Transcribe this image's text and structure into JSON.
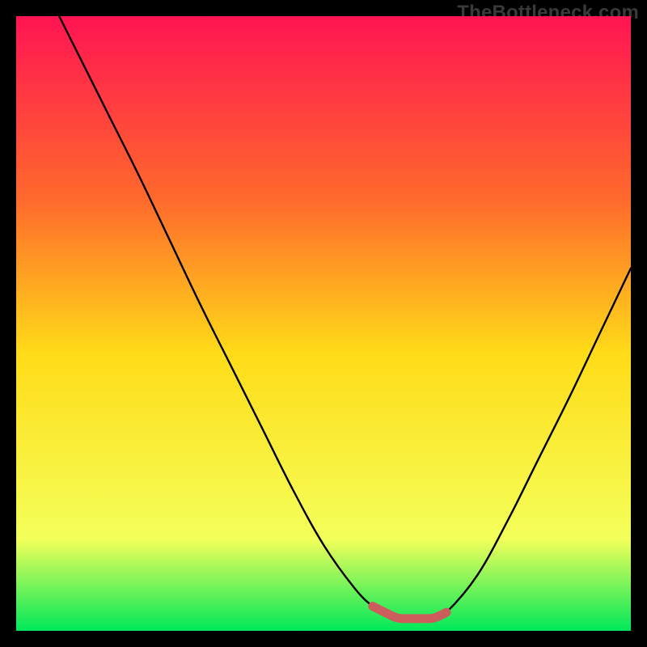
{
  "watermark": "TheBottleneck.com",
  "colors": {
    "gradient_top": "#ff1452",
    "gradient_mid_upper": "#ff6a2c",
    "gradient_mid": "#ffdc18",
    "gradient_lower": "#f4ff5a",
    "gradient_bottom": "#00e85a",
    "curve": "#000000",
    "marker": "#cd5c5c",
    "background": "#000000"
  },
  "chart_data": {
    "type": "line",
    "title": "",
    "xlabel": "",
    "ylabel": "",
    "xlim": [
      0,
      100
    ],
    "ylim": [
      0,
      100
    ],
    "curve": {
      "x": [
        7,
        10,
        15,
        20,
        25,
        30,
        35,
        40,
        45,
        50,
        55,
        58,
        60,
        62,
        65,
        68,
        70,
        75,
        80,
        85,
        90,
        95,
        100
      ],
      "y": [
        100,
        94,
        84,
        74,
        63.5,
        53,
        43,
        33,
        23,
        14,
        7,
        4,
        3,
        2.1,
        2.0,
        2.1,
        3,
        9,
        18,
        28,
        38,
        48.5,
        59
      ]
    },
    "marker_segment": {
      "x": [
        58,
        60,
        62,
        64,
        66,
        68,
        70
      ],
      "y": [
        4,
        3,
        2.1,
        2.0,
        2.0,
        2.1,
        3
      ]
    }
  }
}
